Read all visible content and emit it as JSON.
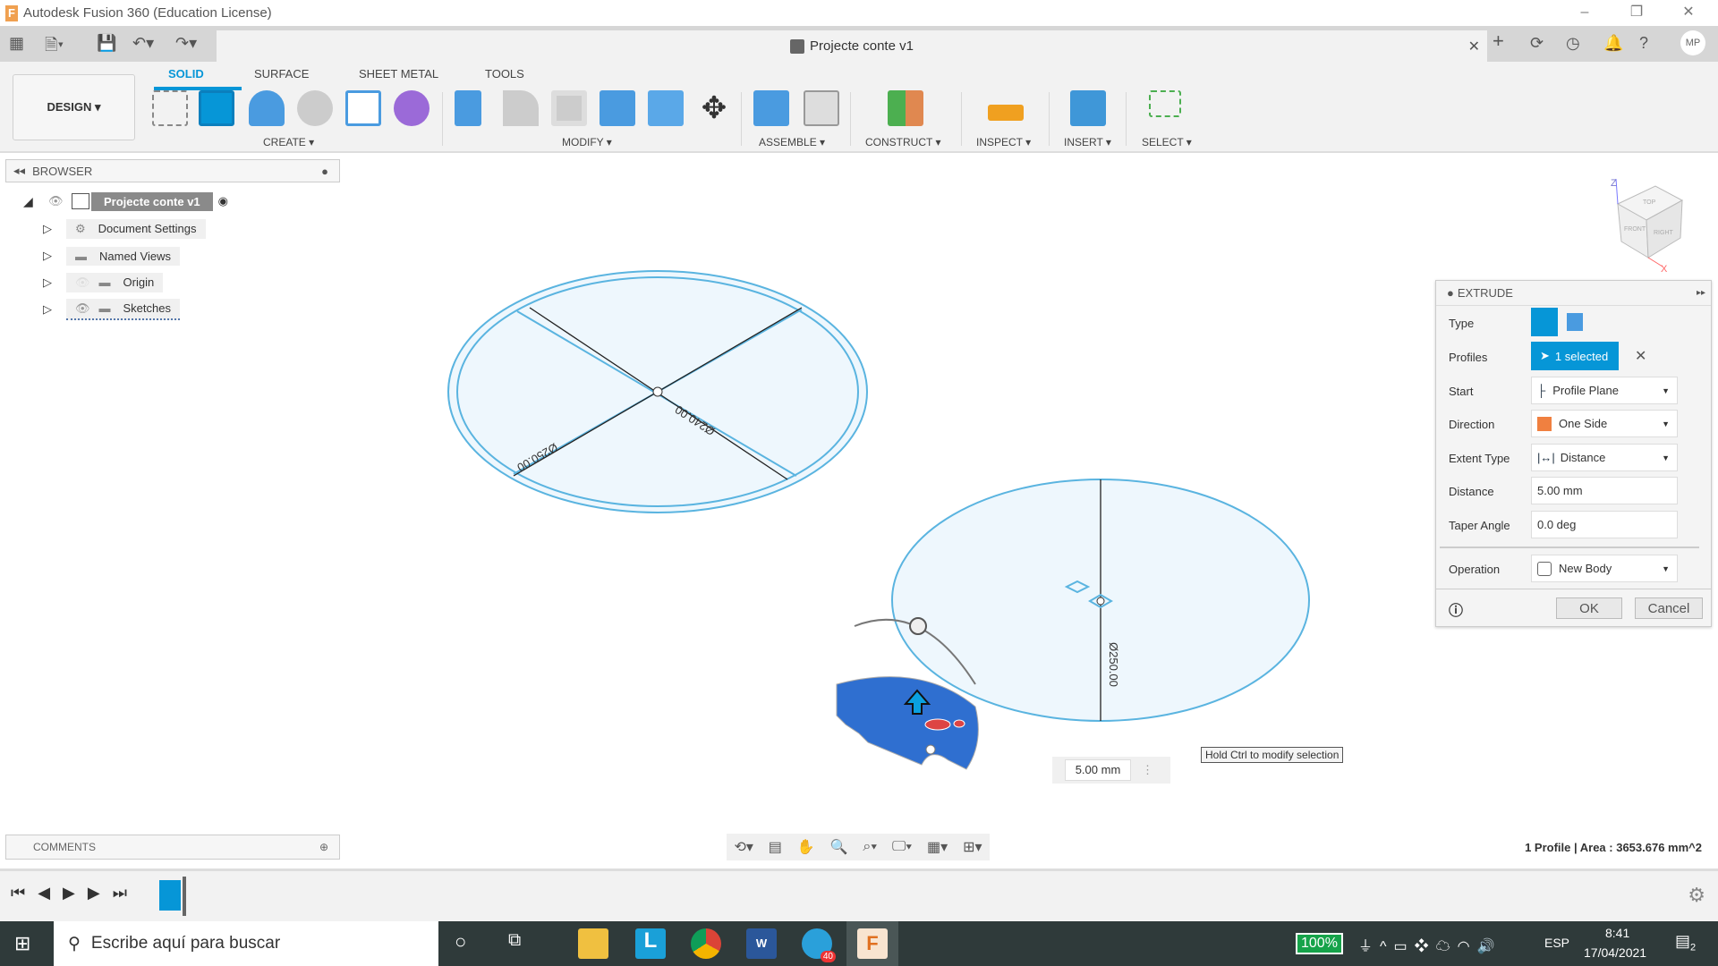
{
  "window": {
    "title": "Autodesk Fusion 360 (Education License)",
    "minimize": "–",
    "restore": "❐",
    "close": "✕"
  },
  "document_tab": {
    "title": "Projecte conte v1",
    "close": "✕",
    "new_tab": "+",
    "user_initials": "MP"
  },
  "toolbar": {
    "workspace": "DESIGN ▾",
    "tabs": [
      {
        "label": "SOLID",
        "active": true
      },
      {
        "label": "SURFACE"
      },
      {
        "label": "SHEET METAL"
      },
      {
        "label": "TOOLS"
      }
    ],
    "groups": [
      "CREATE ▾",
      "MODIFY ▾",
      "ASSEMBLE ▾",
      "CONSTRUCT ▾",
      "INSPECT ▾",
      "INSERT ▾",
      "SELECT ▾"
    ]
  },
  "browser": {
    "title": "BROWSER",
    "root": "Projecte conte v1",
    "items": [
      "Document Settings",
      "Named Views",
      "Origin",
      "Sketches"
    ]
  },
  "viewport": {
    "dimensions": [
      "Ø250.00",
      "Ø240.00",
      "Ø250.00"
    ],
    "distance_input": "5.00 mm",
    "tooltip": "Hold Ctrl to modify selection",
    "status": "1 Profile | Area : 3653.676 mm^2",
    "viewcube": {
      "top": "TOP",
      "front": "FRONT",
      "right": "RIGHT",
      "z": "Z",
      "x": "X"
    }
  },
  "extrude": {
    "title": "EXTRUDE",
    "fields": {
      "type": "Type",
      "profiles": "Profiles",
      "start": "Start",
      "direction": "Direction",
      "extent_type": "Extent Type",
      "distance": "Distance",
      "taper_angle": "Taper Angle",
      "operation": "Operation"
    },
    "profiles_value": "1 selected",
    "start_value": "Profile Plane",
    "direction_value": "One Side",
    "extent_value": "Distance",
    "distance_value": "5.00 mm",
    "taper_value": "0.0 deg",
    "operation_value": "New Body",
    "ok": "OK",
    "cancel": "Cancel"
  },
  "comments": {
    "title": "COMMENTS"
  },
  "taskbar": {
    "search_placeholder": "Escribe aquí para buscar",
    "battery": "100%",
    "language": "ESP",
    "time": "8:41",
    "date": "17/04/2021",
    "notifications": "2",
    "telegram_badge": "40"
  },
  "colors": {
    "accent": "#0696d7",
    "sketch_fill": "#eef7fd",
    "sketch_line": "#5ab4e0",
    "body": "#2f6fd0",
    "taskbar": "#2f3a3a"
  }
}
